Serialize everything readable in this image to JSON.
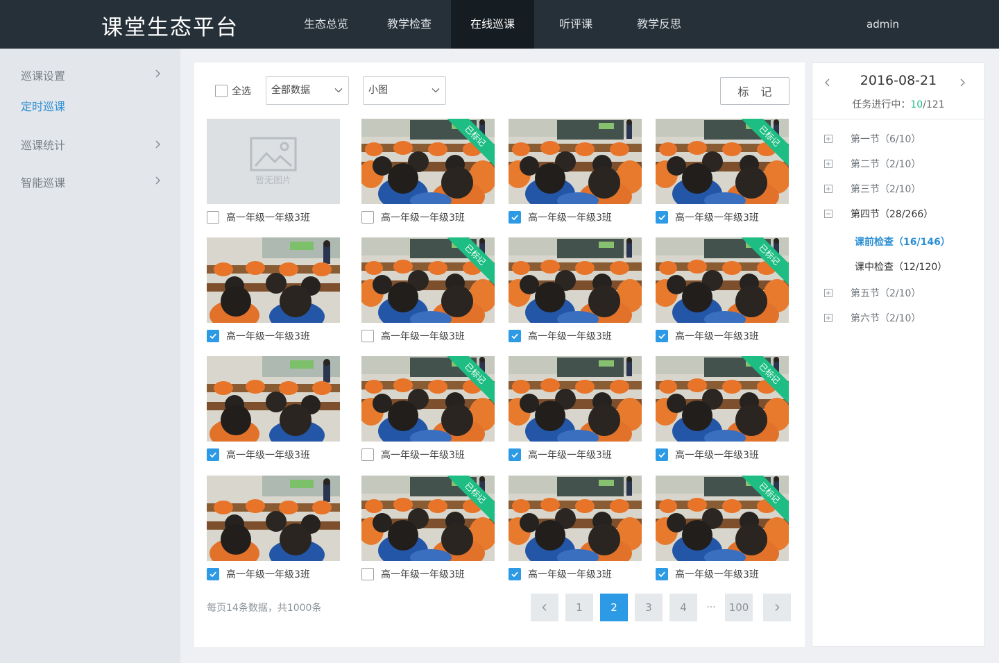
{
  "header": {
    "logo": "课堂生态平台",
    "nav": [
      {
        "label": "生态总览"
      },
      {
        "label": "教学检查"
      },
      {
        "label": "在线巡课"
      },
      {
        "label": "听评课"
      },
      {
        "label": "教学反思"
      }
    ],
    "active_nav": "在线巡课",
    "user": "admin"
  },
  "sidebar": {
    "items": [
      {
        "label": "巡课设置",
        "has_arrow": true
      },
      {
        "label": "定时巡课",
        "has_arrow": false,
        "active": true
      },
      {
        "label": "巡课统计",
        "has_arrow": true
      },
      {
        "label": "智能巡课",
        "has_arrow": true
      }
    ]
  },
  "toolbar": {
    "select_all_label": "全选",
    "filter_value": "全部数据",
    "view_value": "小图",
    "mark_button": "标 记"
  },
  "grid": {
    "marked_ribbon": "已标记",
    "no_image_text": "暂无图片",
    "items": [
      {
        "label": "高一年级一年级3班",
        "checked": false,
        "marked": false,
        "no_image": true,
        "scene": "a"
      },
      {
        "label": "高一年级一年级3班",
        "checked": false,
        "marked": true,
        "no_image": false,
        "scene": "b"
      },
      {
        "label": "高一年级一年级3班",
        "checked": true,
        "marked": false,
        "no_image": false,
        "scene": "b"
      },
      {
        "label": "高一年级一年级3班",
        "checked": true,
        "marked": true,
        "no_image": false,
        "scene": "b"
      },
      {
        "label": "高一年级一年级3班",
        "checked": true,
        "marked": false,
        "no_image": false,
        "scene": "a"
      },
      {
        "label": "高一年级一年级3班",
        "checked": false,
        "marked": true,
        "no_image": false,
        "scene": "b"
      },
      {
        "label": "高一年级一年级3班",
        "checked": true,
        "marked": false,
        "no_image": false,
        "scene": "b"
      },
      {
        "label": "高一年级一年级3班",
        "checked": true,
        "marked": true,
        "no_image": false,
        "scene": "b"
      },
      {
        "label": "高一年级一年级3班",
        "checked": true,
        "marked": false,
        "no_image": false,
        "scene": "a"
      },
      {
        "label": "高一年级一年级3班",
        "checked": false,
        "marked": true,
        "no_image": false,
        "scene": "b"
      },
      {
        "label": "高一年级一年级3班",
        "checked": true,
        "marked": false,
        "no_image": false,
        "scene": "b"
      },
      {
        "label": "高一年级一年级3班",
        "checked": true,
        "marked": true,
        "no_image": false,
        "scene": "b"
      },
      {
        "label": "高一年级一年级3班",
        "checked": true,
        "marked": false,
        "no_image": false,
        "scene": "a"
      },
      {
        "label": "高一年级一年级3班",
        "checked": false,
        "marked": true,
        "no_image": false,
        "scene": "b"
      },
      {
        "label": "高一年级一年级3班",
        "checked": true,
        "marked": false,
        "no_image": false,
        "scene": "b"
      },
      {
        "label": "高一年级一年级3班",
        "checked": true,
        "marked": true,
        "no_image": false,
        "scene": "b"
      }
    ]
  },
  "pagination": {
    "info": "每页14条数据，共1000条",
    "pages": [
      "1",
      "2",
      "3",
      "4"
    ],
    "current": "2",
    "ellipsis": "···",
    "last": "100"
  },
  "calendar": {
    "date": "2016-08-21",
    "progress_label": "任务进行中：",
    "progress_done": "10",
    "progress_total": "/121"
  },
  "sessions": [
    {
      "label": "第一节（6/10）",
      "expanded": false
    },
    {
      "label": "第二节（2/10）",
      "expanded": false
    },
    {
      "label": "第三节（2/10）",
      "expanded": false
    },
    {
      "label": "第四节（28/266）",
      "expanded": true,
      "children": [
        {
          "label": "课前检查（16/146）",
          "active": true
        },
        {
          "label": "课中检查（12/120）",
          "active": false
        }
      ]
    },
    {
      "label": "第五节（2/10）",
      "expanded": false
    },
    {
      "label": "第六节（2/10）",
      "expanded": false
    }
  ],
  "colors": {
    "topbar": "#263038",
    "accent": "#2d9ae6",
    "marked_ribbon": "#1dbd83"
  }
}
